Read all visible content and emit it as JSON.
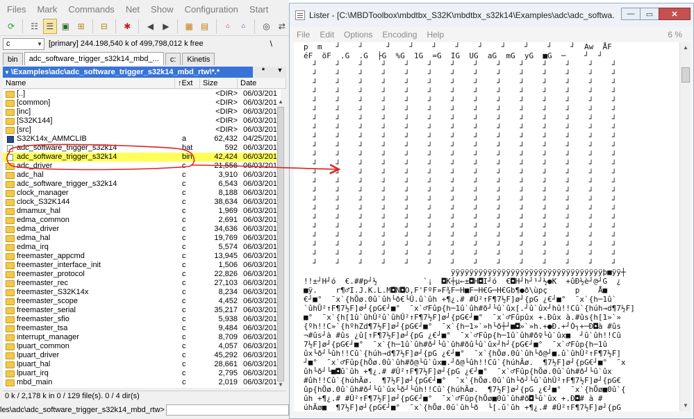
{
  "tc": {
    "menu": [
      "Files",
      "Mark",
      "Commands",
      "Net",
      "Show",
      "Configuration",
      "Start"
    ],
    "toolbar_icons": [
      "refresh-icon",
      "brief-view-icon",
      "detailed-view-icon",
      "thumbnail-icon",
      "tree-icon",
      "branch-icon",
      "filter-icon",
      "back-icon",
      "forward-icon",
      "pack-icon",
      "unpack-icon",
      "ftp-icon",
      "url-icon",
      "binoculars-icon",
      "sync-icon"
    ],
    "drive": {
      "letter": "c",
      "info": "[primary]  244.198,540 k of 499,798,012 k free",
      "root": "\\"
    },
    "tabs": [
      "bin",
      "adc_software_trigger_s32k14_mbd_...",
      "c:",
      "Kinetis"
    ],
    "path": "\\Examples\\adc\\adc_software_trigger_s32k14_mbd_rtw\\*.*",
    "path_filter": "*",
    "columns": {
      "name": "Name",
      "ext": "Ext",
      "sort": "↑",
      "size": "Size",
      "date": "Date"
    },
    "files": [
      {
        "name": "[..]",
        "ext": "",
        "size": "<DIR>",
        "date": "06/03/201",
        "type": "folder"
      },
      {
        "name": "[common]",
        "ext": "",
        "size": "<DIR>",
        "date": "06/03/201",
        "type": "folder"
      },
      {
        "name": "[inc]",
        "ext": "",
        "size": "<DIR>",
        "date": "06/03/201",
        "type": "folder"
      },
      {
        "name": "[S32K144]",
        "ext": "",
        "size": "<DIR>",
        "date": "06/03/201",
        "type": "folder"
      },
      {
        "name": "[src]",
        "ext": "",
        "size": "<DIR>",
        "date": "06/03/201",
        "type": "folder"
      },
      {
        "name": "S32K14x_AMMCLIB",
        "ext": "a",
        "size": "62,432",
        "date": "04/25/201",
        "type": "exe"
      },
      {
        "name": "adc_software_trigger_s32k14",
        "ext": "bat",
        "size": "592",
        "date": "06/03/201",
        "type": "file"
      },
      {
        "name": "adc_software_trigger_s32k14",
        "ext": "bin",
        "size": "42,424",
        "date": "06/03/201",
        "type": "file",
        "selected": true
      },
      {
        "name": "adc_driver",
        "ext": "c",
        "size": "21,556",
        "date": "06/03/201",
        "type": "folder"
      },
      {
        "name": "adc_hal",
        "ext": "c",
        "size": "3,910",
        "date": "06/03/201",
        "type": "folder"
      },
      {
        "name": "adc_software_trigger_s32k14",
        "ext": "c",
        "size": "6,543",
        "date": "06/03/201",
        "type": "folder"
      },
      {
        "name": "clock_manager",
        "ext": "c",
        "size": "8,188",
        "date": "06/03/201",
        "type": "folder"
      },
      {
        "name": "clock_S32K144",
        "ext": "c",
        "size": "38,634",
        "date": "06/03/201",
        "type": "folder"
      },
      {
        "name": "dmamux_hal",
        "ext": "c",
        "size": "1,969",
        "date": "06/03/201",
        "type": "folder"
      },
      {
        "name": "edma_common",
        "ext": "c",
        "size": "2,691",
        "date": "06/03/201",
        "type": "folder"
      },
      {
        "name": "edma_driver",
        "ext": "c",
        "size": "34,636",
        "date": "06/03/201",
        "type": "folder"
      },
      {
        "name": "edma_hal",
        "ext": "c",
        "size": "19,769",
        "date": "06/03/201",
        "type": "folder"
      },
      {
        "name": "edma_irq",
        "ext": "c",
        "size": "5,574",
        "date": "06/03/201",
        "type": "folder"
      },
      {
        "name": "freemaster_appcmd",
        "ext": "c",
        "size": "13,945",
        "date": "06/03/201",
        "type": "folder"
      },
      {
        "name": "freemaster_interface_init",
        "ext": "c",
        "size": "1,506",
        "date": "06/03/201",
        "type": "folder"
      },
      {
        "name": "freemaster_protocol",
        "ext": "c",
        "size": "22,826",
        "date": "06/03/201",
        "type": "folder"
      },
      {
        "name": "freemaster_rec",
        "ext": "c",
        "size": "27,103",
        "date": "06/03/201",
        "type": "folder"
      },
      {
        "name": "freemaster_S32K14x",
        "ext": "c",
        "size": "8,234",
        "date": "06/03/201",
        "type": "folder"
      },
      {
        "name": "freemaster_scope",
        "ext": "c",
        "size": "4,452",
        "date": "06/03/201",
        "type": "folder"
      },
      {
        "name": "freemaster_serial",
        "ext": "c",
        "size": "35,217",
        "date": "06/03/201",
        "type": "folder"
      },
      {
        "name": "freemaster_sfio",
        "ext": "c",
        "size": "5,938",
        "date": "06/03/201",
        "type": "folder"
      },
      {
        "name": "freemaster_tsa",
        "ext": "c",
        "size": "9,484",
        "date": "06/03/201",
        "type": "folder"
      },
      {
        "name": "interrupt_manager",
        "ext": "c",
        "size": "8,709",
        "date": "06/03/201",
        "type": "folder"
      },
      {
        "name": "lpuart_common",
        "ext": "c",
        "size": "4,057",
        "date": "06/03/201",
        "type": "folder"
      },
      {
        "name": "lpuart_driver",
        "ext": "c",
        "size": "45,292",
        "date": "06/03/201",
        "type": "folder"
      },
      {
        "name": "lpuart_hal",
        "ext": "c",
        "size": "28,661",
        "date": "06/03/201",
        "type": "folder"
      },
      {
        "name": "lpuart_irq",
        "ext": "c",
        "size": "2,795",
        "date": "06/03/201",
        "type": "folder"
      },
      {
        "name": "mbd_main",
        "ext": "c",
        "size": "2,019",
        "date": "06/03/201",
        "type": "folder"
      }
    ],
    "status": "0 k / 2,178 k in 0 / 129 file(s). 0 / 4 dir(s)",
    "cmd_prompt": "les\\adc\\adc_software_trigger_s32k14_mbd_rtw>"
  },
  "lister": {
    "title": "Lister - [C:\\MBDToolbox\\mbdtbx_S32K\\mbdtbx_s32k14\\Examples\\adc\\adc_softwa...",
    "window_buttons": [
      "—",
      "▭",
      "✕"
    ],
    "menu": [
      "File",
      "Edit",
      "Options",
      "Encoding",
      "Help"
    ],
    "percent": "6 %",
    "lines": [
      "p  m   ┘    ┘     ┘    ┘    ┘    ┘    ┘    ┘    ┘    ┘    ┘  Aw  ÅF",
      "éF  õF  .G  .G  ├G  %G  1G  =G  IG  UG  aG  mG  yG  ■G  ─    ┘  ┘",
      "  ┘    ┘    ┘    ┘    ┘    ┘    ┘    ┘    ┘    ┘    ┘    ┘    ┘    ┘",
      "  ┘    ┘    ┘    ┘    ┘    ┘    ┘    ┘    ┘    ┘    ┘    ┘    ┘    ┘",
      "  ┘    ┘    ┘    ┘    ┘    ┘    ┘    ┘    ┘    ┘    ┘    ┘    ┘    ┘",
      "  ┘    ┘    ┘    ┘    ┘    ┘    ┘    ┘    ┘    ┘    ┘    ┘    ┘    ┘",
      "  ┘    ┘    ┘    ┘    ┘    ┘    ┘    ┘    ┘    ┘    ┘    ┘    ┘    ┘",
      "  ┘    ┘    ┘    ┘    ┘    ┘    ┘    ┘    ┘    ┘    ┘    ┘    ┘    ┘",
      "  ┘    ┘    ┘    ┘    ┘    ┘    ┘    ┘    ┘    ┘    ┘    ┘    ┘    ┘",
      "  ┘    ┘    ┘    ┘    ┘    ┘    ┘    ┘    ┘    ┘    ┘    ┘    ┘    ┘",
      "  ┘    ┘    ┘    ┘    ┘    ┘    ┘    ┘    ┘    ┘    ┘    ┘    ┘    ┘",
      "  ┘    ┘    ┘    ┘    ┘    ┘    ┘    ┘    ┘    ┘    ┘    ┘    ┘    ┘",
      "  ┘    ┘    ┘    ┘    ┘    ┘    ┘    ┘    ┘    ┘    ┘    ┘    ┘    ┘",
      "  ┘    ┘    ┘    ┘    ┘    ┘    ┘    ┘    ┘    ┘    ┘    ┘    ┘    ┘",
      "  ┘    ┘    ┘    ┘    ┘    ┘    ┘    ┘    ┘    ┘    ┘    ┘    ┘    ┘",
      "  ┘    ┘    ┘    ┘    ┘    ┘    ┘    ┘    ┘    ┘    ┘    ┘    ┘    ┘",
      "  ┘    ┘    ┘    ┘    ┘    ┘    ┘    ┘    ┘    ┘    ┘    ┘    ┘    ┘",
      "  ┘    ┘    ┘    ┘    ┘    ┘    ┘    ┘    ┘    ┘    ┘    ┘    ┘    ┘",
      "  ┘    ┘    ┘    ┘    ┘    ┘    ┘    ┘    ┘    ┘    ┘    ┘    ┘    ┘",
      "  ┘    ┘    ┘    ┘    ┘    ┘    ┘    ┘    ┘    ┘    ┘    ┘    ┘    ┘",
      "  ┘    ┘    ┘    ┘    ┘    ┘    ┘    ┘    ┘    ┘    ┘    ┘    ┘    ┘",
      "  ┘    ┘    ┘    ┘    ┘    ┘    ┘    ┘    ┘    ┘    ┘    ┘    ┘    ┘",
      "  ┘    ┘    ┘    ┘    ┘    ┘    ┘    ┘    ┘    ┘    ┘    ┘    ┘    ┘",
      "  ┘    ┘    ┘    ┘    ┘    ┘    ┘    ┘    ┘    ┘    ┘    ┘    ┘    ┘",
      "  ┘    ┘    ┘    ┘    ┘    ┘    ┘    ┘    ┘    ┘    ┘    ┘    ┘    ┘",
      "                                ÿÿÿÿÿÿÿÿÿÿÿÿÿÿÿÿÿÿÿÿÿÿÿÿÿÿÿÿÿÿÿÿÿþ■ÿÿ┼",
      "!!±┘H┘ó  €.##p┘½          `¡  ◘K┼µ←±◘H◘I┘ó  €◘H┘h┘¹┘½●K  +ûÐ½è┘@┘G  ¿",
      "■ÿ.    r¶♂I.J.K.L.M◘N◘O,F'FºF»F¾F─H■F─H€G─H€Gb¶●ð\\ùpç      p    Å■",
      "€┘■°  ¯x`{hÕø.0û`ûh└ð€└Û.û`ûh +¶¿.# #Û²↑F¶7½F]ø┘{pG ¿€┘■°  ¯x`{h─1û`",
      "`ûhÛ²↑F¶7½F]ø┘{pG€┘■°  ¯x`♂Fûp{h─1û`ûh#ð┘└û`ûx[.┘û`ûx┘hû!!Cû`{húh→d¶7½F]",
      "■°  ¯x`{h[1û`ûhÛ²û`ûhÛ²↑F¶7½F]ø┘{pG€┘■°  ¯x`♂Fûpûx +.Ðûx à.#ûs{h[1»`»",
      "{ºh!!C»`{hºhZd¶7½F]ø┘{pG€┘■°  ¯x`{h─1»`»h└ð┼┘■◘»`»h.+●Ð.+┘Ó┐+─Ð◘à #ûs",
      "¬#ûs┘à #ûs ¿û[↑F¶7½F]ø┘{pG ¿€┘■°  ¯x`♂Fûp{h─1û`ûh#ð♀└û`ûx■  ┘û`ûh!!Cû",
      "7½F]ø┘{pG€┘■°  ¯x`{h─1û`ûh#ð┘└û`ûh#ðû└û`ûx┘h┘{pG€┘■°  ¯x`♂Fûp{h─1û",
      "ûx└ð┘└ûh!!Cû`{húh→d¶7½F]ø┘{pG ¿€┘■°  ¯x`{hÕø.0û`ûh└ð@┘■.û`ûhÛ²↑F¶7½F]",
      "┘■°  ¯x`♂Fûp{hÕø.0û`ûh#ð@└û`ûx■.┘ð@└ûh!!Cû`{húhÃø.  ¶7½F]ø┘{pG€┘■°  ¯x",
      "ûh└ð┘└■◘û`ûh +¶¿.# #Û²↑F¶7½F]ø┘{pG ¿€┘■°  ¯x`♂Fûp{hÕø.0û`ûh#ð┘└û`ûx",
      "#ûh!!Cû`{húhÃø.  ¶7½F]ø┘{pG€┘■°  ¯x`{hÕø.0û`ûh└ð┘└û`ûhÛ²↑F¶7½F]ø┘{pG€",
      "ûp{hÕø.0û`ûh#ð┘└û`ûx└ð┘└ûh!!Cû`{húhÃø.  ¶7½F]ø┘{pG ¿€┘■°  ¯x`{hÕø■0û`{",
      "ûh +¶¿.# #Û²↑F¶7½F]ø┘{pG€┘■°  ¯x`♂Fûp{hÕø■0û`ûh#ð◘└û`ûx +.Ð◘# à #",
      "úhÃø■  ¶7½F]ø┘{pG€┘■°  ¯x`{hÕø.0û`ûh└ð  └[.û`ûh +¶¿.# #Û²↑F¶7½F]ø┘{pG",
      "`♂Fûp{hÕø.0û`ûh#ð  ┘û`ûx +.Ð # à #ûh!!Cû`{húhÃø.  ¶7½F]ø┘{pG€┘■°  ¯x`{",
      "└ð┘┼←.û`ûh +¶¿.# #Û²↑F¶7½F]ø┘{pG ¿€┘■°  ¯x`♂Fûp{hÕø.0û`ûh#ð┘└û`ûx +",
      "h!!Cû`{húhÃø.  ¶7½F]ø┘{pG€┘■°  ¯x`{hÕø.0û`ûh└ð◘└Û◘û`ûh +¶¿.# #Û²↑F¶7½F]"
    ]
  },
  "annotation": {
    "color": "#e02020"
  }
}
